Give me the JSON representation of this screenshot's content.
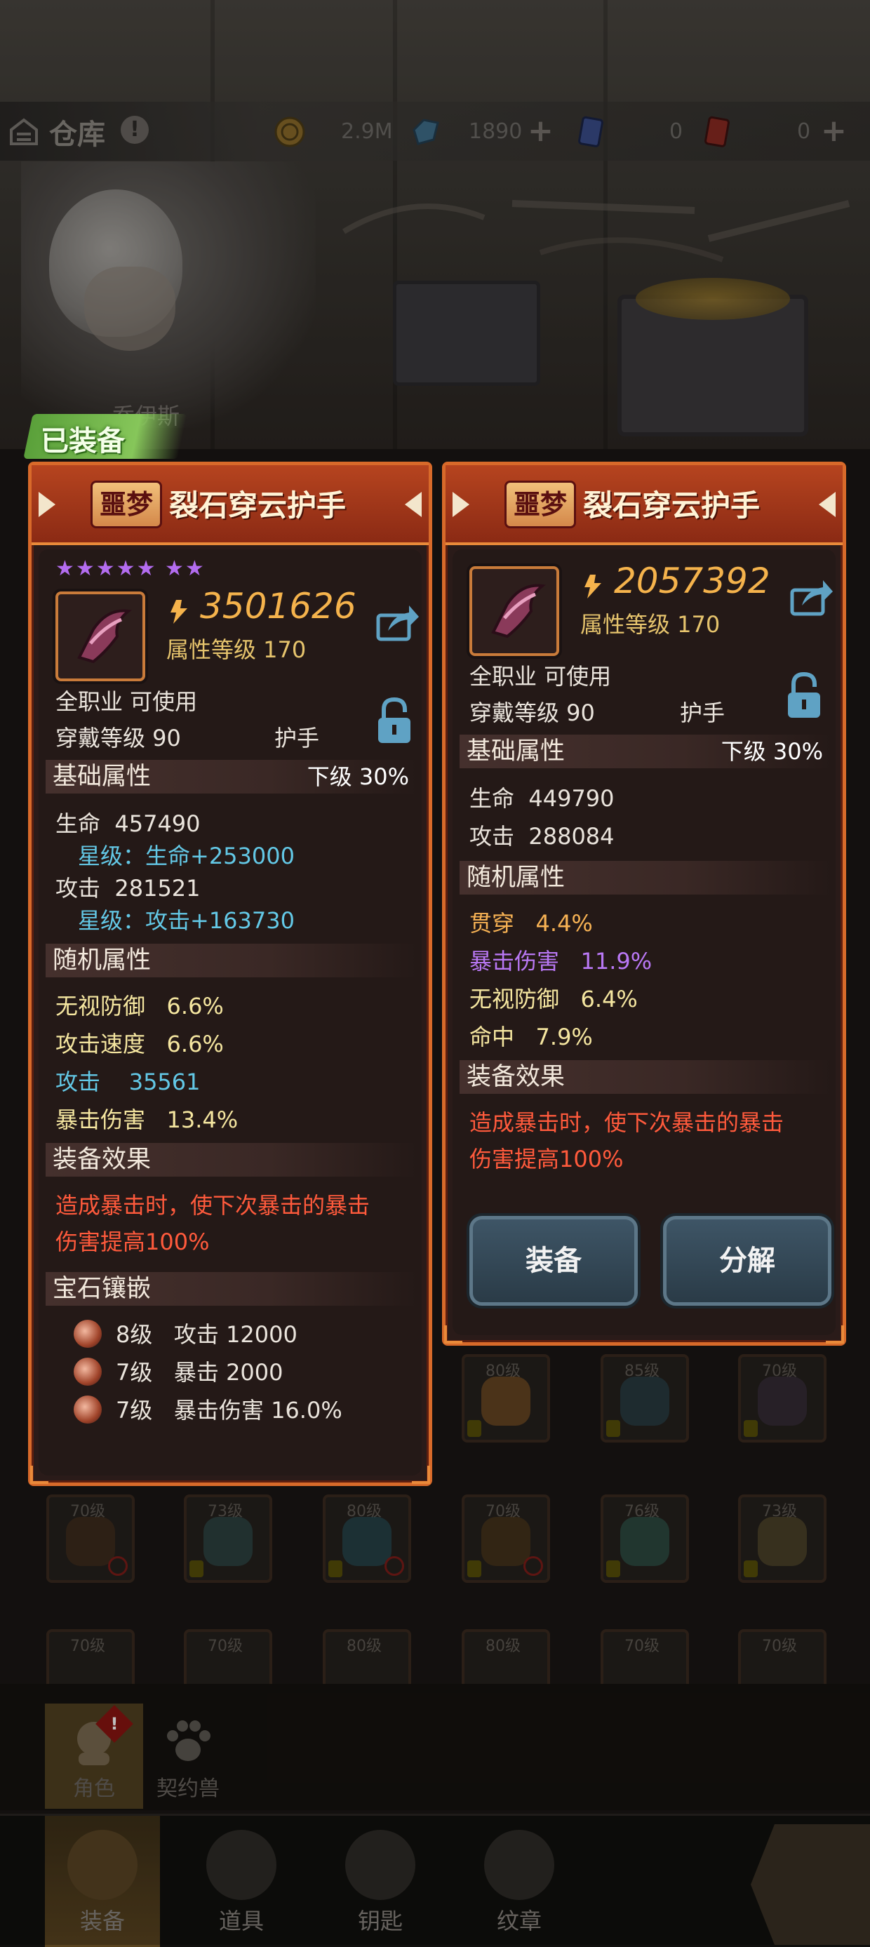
{
  "topbar": {
    "title": "仓库",
    "help_glyph": "!",
    "gold": "2.9M",
    "diamond": "1890",
    "blue_ticket": "0",
    "red_ticket": "0"
  },
  "hero_name": "乔伊斯",
  "equipped_label": "已装备",
  "left_card": {
    "rarity": "噩梦",
    "name": "裂石穿云护手",
    "stars": "★★★★★  ★★",
    "power": "3501626",
    "attr_level": "属性等级 170",
    "class": "全职业 可使用",
    "wear_level": "穿戴等级 90",
    "slot": "护手",
    "base_title": "基础属性",
    "base_grade": "下级  30%",
    "base": [
      {
        "k": "生命",
        "v": "457490",
        "star": "星级：生命+253000"
      },
      {
        "k": "攻击",
        "v": "281521",
        "star": "星级：攻击+163730"
      }
    ],
    "random_title": "随机属性",
    "random": [
      {
        "k": "无视防御",
        "v": "6.6%"
      },
      {
        "k": "攻击速度",
        "v": "6.6%"
      },
      {
        "k": "攻击",
        "v": "35561"
      },
      {
        "k": "暴击伤害",
        "v": "13.4%"
      }
    ],
    "effect_title": "装备效果",
    "effect_1": "造成暴击时，使下次暴击的暴击",
    "effect_2": "伤害提高100%",
    "gem_title": "宝石镶嵌",
    "gems": [
      {
        "lv": "8级",
        "txt": "攻击 12000"
      },
      {
        "lv": "7级",
        "txt": "暴击 2000"
      },
      {
        "lv": "7级",
        "txt": "暴击伤害 16.0%"
      }
    ]
  },
  "right_card": {
    "rarity": "噩梦",
    "name": "裂石穿云护手",
    "power": "2057392",
    "attr_level": "属性等级 170",
    "class": "全职业 可使用",
    "wear_level": "穿戴等级 90",
    "slot": "护手",
    "base_title": "基础属性",
    "base_grade": "下级  30%",
    "base": [
      {
        "k": "生命",
        "v": "449790"
      },
      {
        "k": "攻击",
        "v": "288084"
      }
    ],
    "random_title": "随机属性",
    "random": [
      {
        "k": "贯穿",
        "v": "4.4%"
      },
      {
        "k": "暴击伤害",
        "v": "11.9%"
      },
      {
        "k": "无视防御",
        "v": "6.4%"
      },
      {
        "k": "命中",
        "v": "7.9%"
      }
    ],
    "effect_title": "装备效果",
    "effect_1": "造成暴击时，使下次暴击的暴击",
    "effect_2": "伤害提高100%",
    "equip_button": "装备",
    "dismantle_button": "分解"
  },
  "grid_levels": {
    "r1": [
      "80级",
      "85级",
      "70级"
    ],
    "r2": [
      "70级",
      "73级",
      "80级",
      "70级",
      "76级",
      "73级"
    ],
    "r3": [
      "70级",
      "70级",
      "80级",
      "80级",
      "70级",
      "70级"
    ]
  },
  "subtabs": {
    "role": "角色",
    "pet": "契约兽",
    "alert": "!"
  },
  "nav": {
    "equip": "装备",
    "items": "道具",
    "keys": "钥匙",
    "emblem": "纹章"
  },
  "colors": {
    "card_border": "#d86a2a",
    "power": "#f5b34c",
    "star": "#b36cf0",
    "stat_cyan": "#63c8e6",
    "effect_red": "#ff5a3c"
  }
}
